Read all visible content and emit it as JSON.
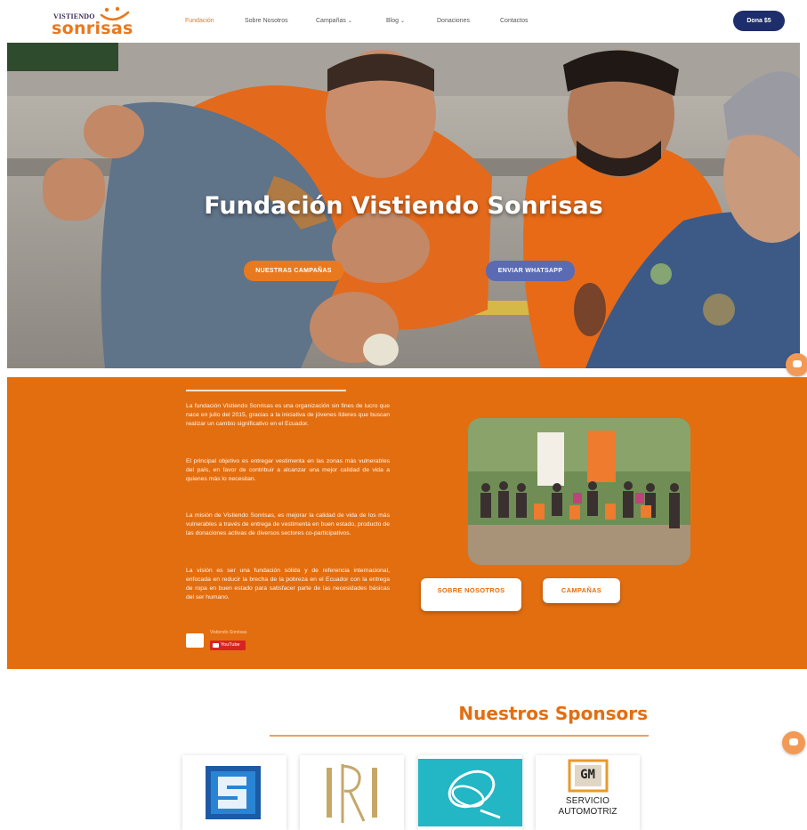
{
  "header": {
    "logo_top": "VISTIENDO",
    "logo_main": "sonrisas",
    "nav": [
      {
        "label": "Fundación",
        "active": true
      },
      {
        "label": "Sobre Nosotros"
      },
      {
        "label": "Campañas",
        "dropdown": true
      },
      {
        "label": "Blog",
        "dropdown": true
      },
      {
        "label": "Donaciones"
      },
      {
        "label": "Contactos"
      }
    ],
    "donate_label": "Dona $5"
  },
  "hero": {
    "title": "Fundación Vistiendo Sonrisas",
    "primary_button": "NUESTRAS CAMPAÑAS",
    "secondary_button": "ENVIAR WHATSAPP"
  },
  "about": {
    "paragraphs": [
      "La fundación Vistiendo Sonrisas es una organización sin fines de lucro que nace en julio del 2015, gracias a la iniciativa de jóvenes líderes que buscan realizar un cambio significativo en el Ecuador.",
      "El principal objetivo es entregar vestimenta en las zonas más vulnerables del país, en favor de contribuir a alcanzar una mejor calidad de vida a quienes más lo necesitan.",
      "La misión de Vistiendo Sonrisas, es mejorar la calidad de vida de los más vulnerables a través de entrega de vestimenta en buen estado, producto de las donaciones activas de diversos sectores co-participativos.",
      "La visión es ser una fundación sólida y de referencia internacional, enfocada en reducir la brecha de la pobreza en el Ecuador con la entrega de ropa en buen estado para satisfacer parte de las necesidades básicas del ser humano."
    ],
    "youtube_channel": "Vistiendo Sonrisas",
    "youtube_label": "YouTube",
    "button_about": "SOBRE NOSOTROS",
    "button_campaigns": "CAMPAÑAS"
  },
  "sponsors": {
    "title": "Nuestros Sponsors",
    "gm_logo_text": "GM",
    "gm_logo_sub": "SERVICIO",
    "gm_logo_sub2": "AUTOMOTRIZ"
  },
  "colors": {
    "brand_orange": "#e36e10",
    "navy": "#1e2d6b",
    "whatsapp_button": "#5a6ab3"
  },
  "icons": [
    "logo-smile-icon",
    "chevron-down-icon",
    "chat-icon",
    "youtube-icon"
  ]
}
